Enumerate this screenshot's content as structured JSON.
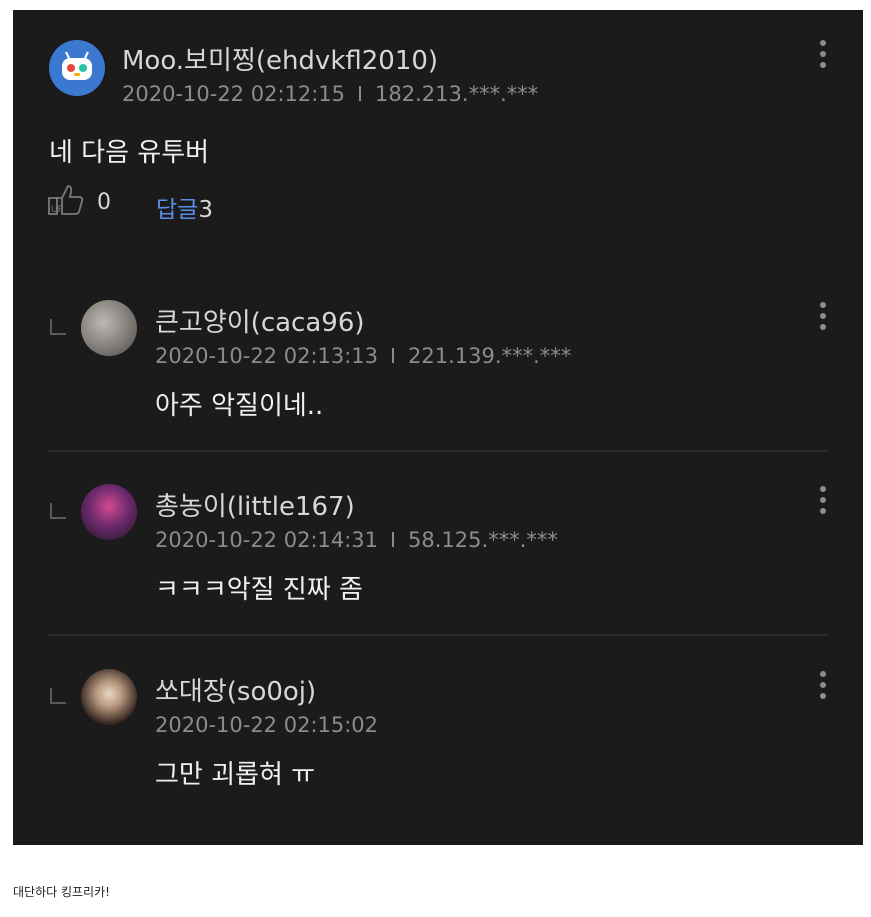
{
  "comment": {
    "author": "Moo.보미찡(ehdvkfl2010)",
    "date": "2020-10-22 02:12:15",
    "ip": "182.213.***.***",
    "text": "네 다음 유투버",
    "like_count": "0",
    "reply_label": "답글",
    "reply_count": "3"
  },
  "replies": [
    {
      "author": "큰고양이(caca96)",
      "date": "2020-10-22 02:13:13",
      "ip": "221.139.***.***",
      "text": "아주 악질이네.."
    },
    {
      "author": "총농이(little167)",
      "date": "2020-10-22 02:14:31",
      "ip": "58.125.***.***",
      "text": "ㅋㅋㅋ악질 진짜 좀"
    },
    {
      "author": "쏘대장(so0oj)",
      "date": "2020-10-22 02:15:02",
      "ip": "",
      "text": "그만 괴롭혀 ㅠ"
    }
  ],
  "caption": "대단하다 킹프리카!",
  "colors": {
    "background": "#1b1b1c",
    "reply_link": "#5b8ee6",
    "text": "#f0f0f0",
    "meta": "#8c8c8c"
  }
}
